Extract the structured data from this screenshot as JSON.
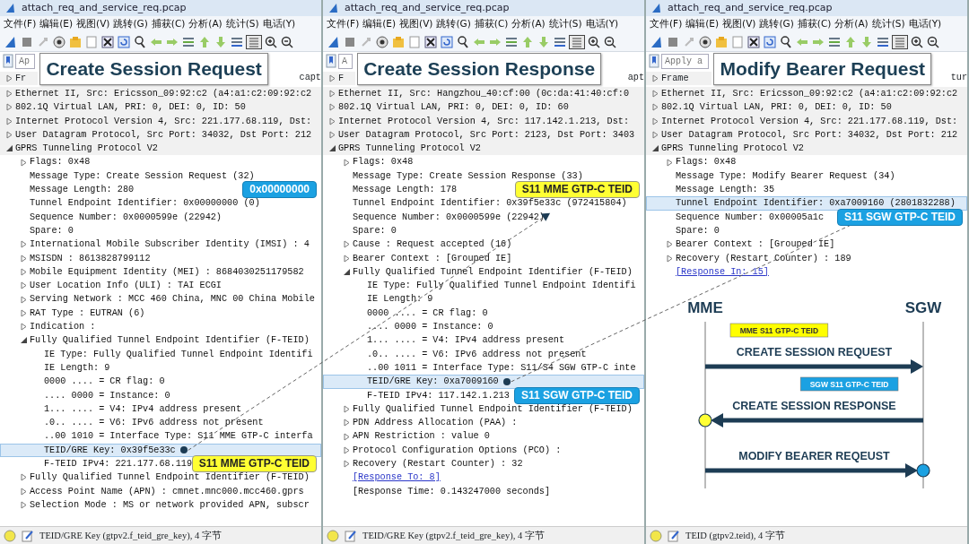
{
  "panes": [
    {
      "window_title": "attach_req_and_service_req.pcap",
      "menu": [
        "文件(F)",
        "编辑(E)",
        "视图(V)",
        "跳转(G)",
        "捕获(C)",
        "分析(A)",
        "统计(S)",
        "电话(Y)"
      ],
      "filter": {
        "placeholder": "Ap"
      },
      "title_label": "Create Session Request",
      "tree": [
        {
          "text": "Fr",
          "tail": "capt",
          "kind": "collapsed",
          "selected": false
        },
        {
          "text": "Ethernet II, Src: Ericsson_09:92:c2 (a4:a1:c2:09:92:c2",
          "kind": "collapsed",
          "selected": false
        },
        {
          "text": "802.1Q Virtual LAN, PRI: 0, DEI: 0, ID: 50",
          "kind": "collapsed",
          "selected": false
        },
        {
          "text": "Internet Protocol Version 4, Src: 221.177.68.119, Dst:",
          "kind": "collapsed",
          "selected": false
        },
        {
          "text": "User Datagram Protocol, Src Port: 34032, Dst Port: 212",
          "kind": "collapsed",
          "selected": false
        },
        {
          "text": "GPRS Tunneling Protocol V2",
          "kind": "expanded",
          "selected": false,
          "children": [
            {
              "text": "Flags: 0x48",
              "kind": "collapsed",
              "selected": false
            },
            {
              "text": "Message Type: Create Session Request (32)",
              "kind": "leaf",
              "selected": false
            },
            {
              "text": "Message Length: 280",
              "kind": "leaf",
              "selected": false,
              "callout": {
                "text": "0x00000000",
                "color": "#1ba1e2"
              }
            },
            {
              "text": "Tunnel Endpoint Identifier: 0x00000000 (0)",
              "kind": "leaf",
              "selected": false
            },
            {
              "text": "Sequence Number: 0x0000599e (22942)",
              "kind": "leaf",
              "selected": false
            },
            {
              "text": "Spare: 0",
              "kind": "leaf",
              "selected": false
            },
            {
              "text": "International Mobile Subscriber Identity (IMSI) : 4",
              "kind": "collapsed",
              "selected": false
            },
            {
              "text": "MSISDN : 8613828799112",
              "kind": "collapsed",
              "selected": false
            },
            {
              "text": "Mobile Equipment Identity (MEI) : 8684030251179582",
              "kind": "collapsed",
              "selected": false
            },
            {
              "text": "User Location Info (ULI) : TAI ECGI",
              "kind": "collapsed",
              "selected": false
            },
            {
              "text": "Serving Network : MCC 460 China, MNC 00 China Mobile",
              "kind": "collapsed",
              "selected": false
            },
            {
              "text": "RAT Type : EUTRAN (6)",
              "kind": "collapsed",
              "selected": false
            },
            {
              "text": "Indication :",
              "kind": "collapsed",
              "selected": false
            },
            {
              "text": "Fully Qualified Tunnel Endpoint Identifier (F-TEID)",
              "kind": "expanded",
              "selected": false,
              "children": [
                {
                  "text": "IE Type: Fully Qualified Tunnel Endpoint Identifi",
                  "kind": "leaf",
                  "selected": false
                },
                {
                  "text": "IE Length: 9",
                  "kind": "leaf",
                  "selected": false
                },
                {
                  "text": "0000 .... = CR flag: 0",
                  "kind": "leaf",
                  "selected": false
                },
                {
                  "text": ".... 0000 = Instance: 0",
                  "kind": "leaf",
                  "selected": false
                },
                {
                  "text": "1... .... = V4: IPv4 address present",
                  "kind": "leaf",
                  "selected": false
                },
                {
                  "text": ".0.. .... = V6: IPv6 address not present",
                  "kind": "leaf",
                  "selected": false
                },
                {
                  "text": "..00 1010 = Interface Type: S11 MME GTP-C interfa",
                  "kind": "leaf",
                  "selected": false
                },
                {
                  "text": "TEID/GRE Key: 0x39f5e33c",
                  "kind": "marked",
                  "selected": true
                },
                {
                  "text": "F-TEID IPv4: 221.177.68.119",
                  "kind": "leaf",
                  "selected": false,
                  "callout": {
                    "text": "S11 MME GTP-C TEID",
                    "color": "#ffff33"
                  }
                }
              ]
            },
            {
              "text": "Fully Qualified Tunnel Endpoint Identifier (F-TEID)",
              "kind": "collapsed",
              "selected": false
            },
            {
              "text": "Access Point Name (APN) : cmnet.mnc000.mcc460.gprs",
              "kind": "collapsed",
              "selected": false
            },
            {
              "text": "Selection Mode : MS or network provided APN, subscr",
              "kind": "collapsed",
              "selected": false
            }
          ]
        }
      ],
      "status_text": "TEID/GRE Key (gtpv2.f_teid_gre_key), 4 字节"
    },
    {
      "window_title": "attach_req_and_service_req.pcap",
      "menu": [
        "文件(F)",
        "编辑(E)",
        "视图(V)",
        "跳转(G)",
        "捕获(C)",
        "分析(A)",
        "统计(S)",
        "电话(Y)"
      ],
      "filter": {
        "placeholder": "A"
      },
      "title_label": "Create Session Response",
      "tree": [
        {
          "text": "F",
          "tail": "apt",
          "kind": "collapsed",
          "selected": false
        },
        {
          "text": "Ethernet II, Src: Hangzhou_40:cf:00 (0c:da:41:40:cf:0",
          "kind": "collapsed",
          "selected": false
        },
        {
          "text": "802.1Q Virtual LAN, PRI: 0, DEI: 0, ID: 60",
          "kind": "collapsed",
          "selected": false
        },
        {
          "text": "Internet Protocol Version 4, Src: 117.142.1.213, Dst:",
          "kind": "collapsed",
          "selected": false
        },
        {
          "text": "User Datagram Protocol, Src Port: 2123, Dst Port: 3403",
          "kind": "collapsed",
          "selected": false
        },
        {
          "text": "GPRS Tunneling Protocol V2",
          "kind": "expanded",
          "selected": false,
          "children": [
            {
              "text": "Flags: 0x48",
              "kind": "collapsed",
              "selected": false
            },
            {
              "text": "Message Type: Create Session Response (33)",
              "kind": "leaf",
              "selected": false
            },
            {
              "text": "Message Length: 178",
              "kind": "leaf",
              "selected": false,
              "callout": {
                "text": "S11 MME GTP-C TEID",
                "color": "#ffff33"
              }
            },
            {
              "text": "Tunnel Endpoint Identifier: 0x39f5e33c (972415804)",
              "kind": "target",
              "selected": false
            },
            {
              "text": "Sequence Number: 0x0000599e (22942)",
              "kind": "leaf",
              "selected": false
            },
            {
              "text": "Spare: 0",
              "kind": "leaf",
              "selected": false
            },
            {
              "text": "Cause : Request accepted (16)",
              "kind": "collapsed",
              "selected": false
            },
            {
              "text": "Bearer Context : [Grouped IE]",
              "kind": "collapsed",
              "selected": false
            },
            {
              "text": "Fully Qualified Tunnel Endpoint Identifier (F-TEID)",
              "kind": "expanded",
              "selected": false,
              "children": [
                {
                  "text": "IE Type: Fully Qualified Tunnel Endpoint Identifi",
                  "kind": "leaf",
                  "selected": false
                },
                {
                  "text": "IE Length: 9",
                  "kind": "leaf",
                  "selected": false
                },
                {
                  "text": "0000 .... = CR flag: 0",
                  "kind": "leaf",
                  "selected": false
                },
                {
                  "text": ".... 0000 = Instance: 0",
                  "kind": "leaf",
                  "selected": false
                },
                {
                  "text": "1... .... = V4: IPv4 address present",
                  "kind": "leaf",
                  "selected": false
                },
                {
                  "text": ".0.. .... = V6: IPv6 address not present",
                  "kind": "leaf",
                  "selected": false
                },
                {
                  "text": "..00 1011 = Interface Type: S11/S4 SGW GTP-C inte",
                  "kind": "leaf",
                  "selected": false
                },
                {
                  "text": "TEID/GRE Key: 0xa7009160",
                  "kind": "marked",
                  "selected": true
                },
                {
                  "text": "F-TEID IPv4: 117.142.1.213",
                  "kind": "leaf",
                  "selected": false,
                  "callout": {
                    "text": "S11 SGW GTP-C TEID",
                    "color": "#1ba1e2"
                  }
                }
              ]
            },
            {
              "text": "Fully Qualified Tunnel Endpoint Identifier (F-TEID)",
              "kind": "collapsed",
              "selected": false
            },
            {
              "text": "PDN Address Allocation (PAA) :",
              "kind": "collapsed",
              "selected": false
            },
            {
              "text": "APN Restriction : value 0",
              "kind": "collapsed",
              "selected": false
            },
            {
              "text": "Protocol Configuration Options (PCO) :",
              "kind": "collapsed",
              "selected": false
            },
            {
              "text": "Recovery (Restart Counter) : 32",
              "kind": "collapsed",
              "selected": false
            },
            {
              "text": "[Response To: 8]",
              "kind": "link",
              "selected": false
            },
            {
              "text": "[Response Time: 0.143247000 seconds]",
              "kind": "leaf",
              "selected": false
            }
          ]
        }
      ],
      "status_text": "TEID/GRE Key (gtpv2.f_teid_gre_key), 4 字节"
    },
    {
      "window_title": "attach_req_and_service_req.pcap",
      "menu": [
        "文件(F)",
        "编辑(E)",
        "视图(V)",
        "跳转(G)",
        "捕获(C)",
        "分析(A)",
        "统计(S)",
        "电话(Y)"
      ],
      "filter": {
        "placeholder": "Apply a"
      },
      "title_label": "Modify Bearer Request",
      "tree": [
        {
          "text": "Frame",
          "tail": "tur",
          "kind": "collapsed",
          "selected": false
        },
        {
          "text": "Ethernet II, Src: Ericsson_09:92:c2 (a4:a1:c2:09:92:c2",
          "kind": "collapsed",
          "selected": false
        },
        {
          "text": "802.1Q Virtual LAN, PRI: 0, DEI: 0, ID: 50",
          "kind": "collapsed",
          "selected": false
        },
        {
          "text": "Internet Protocol Version 4, Src: 221.177.68.119, Dst:",
          "kind": "collapsed",
          "selected": false
        },
        {
          "text": "User Datagram Protocol, Src Port: 34032, Dst Port: 212",
          "kind": "collapsed",
          "selected": false
        },
        {
          "text": "GPRS Tunneling Protocol V2",
          "kind": "expanded",
          "selected": false,
          "children": [
            {
              "text": "Flags: 0x48",
              "kind": "collapsed",
              "selected": false
            },
            {
              "text": "Message Type: Modify Bearer Request (34)",
              "kind": "leaf",
              "selected": false
            },
            {
              "text": "Message Length: 35",
              "kind": "leaf",
              "selected": false
            },
            {
              "text": "Tunnel Endpoint Identifier: 0xa7009160 (2801832288)",
              "kind": "target",
              "selected": true
            },
            {
              "text": "Sequence Number: 0x00005a1c",
              "kind": "leaf",
              "selected": false,
              "callout": {
                "text": "S11 SGW GTP-C TEID",
                "color": "#1ba1e2"
              }
            },
            {
              "text": "Spare: 0",
              "kind": "leaf",
              "selected": false
            },
            {
              "text": "Bearer Context : [Grouped IE]",
              "kind": "collapsed",
              "selected": false
            },
            {
              "text": "Recovery (Restart Counter) : 189",
              "kind": "collapsed",
              "selected": false
            },
            {
              "text": "[Response In: 15]",
              "kind": "link",
              "selected": false
            }
          ]
        }
      ],
      "sequence_diagram": {
        "entities": [
          "MME",
          "SGW"
        ],
        "messages": [
          {
            "label": "CREATE SESSION REQUEST",
            "kind": "right",
            "tag": {
              "text": "MME S11 GTP-C TEID",
              "color": "#ffff00"
            }
          },
          {
            "label": "CREATE SESSION RESPONSE",
            "kind": "left",
            "tag": {
              "text": "SGW S11 GTP-C TEID",
              "color": "#1ba1e2"
            },
            "dot": {
              "color": "#ffff33"
            }
          },
          {
            "label": "MODIFY BEARER REQEUST",
            "kind": "right",
            "dot": {
              "color": "#1ba1e2"
            }
          }
        ]
      },
      "status_text": "TEID (gtpv2.teid), 4 字节"
    }
  ]
}
